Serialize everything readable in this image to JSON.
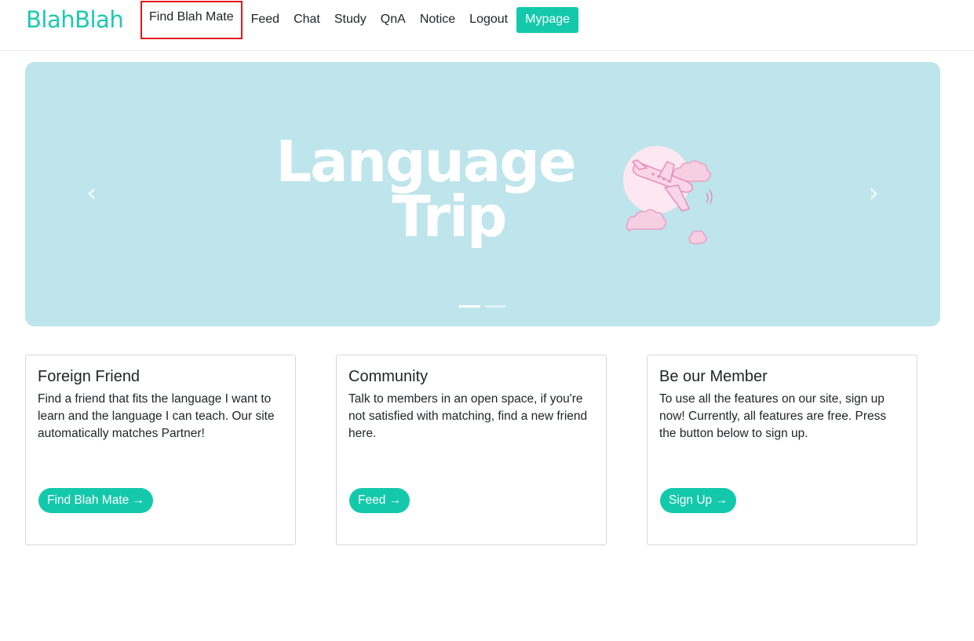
{
  "brand": "BlahBlah",
  "nav": {
    "items": [
      "Find Blah Mate",
      "Feed",
      "Chat",
      "Study",
      "QnA",
      "Notice",
      "Logout"
    ],
    "mypage": "Mypage"
  },
  "carousel": {
    "title_line1": "Language",
    "title_line2": "Trip",
    "prev_icon": "‹",
    "next_icon": "›",
    "slides": 2,
    "active_slide": 1
  },
  "cards": [
    {
      "title": "Foreign Friend",
      "text": "Find a friend that fits the language I want to learn and the language I can teach. Our site automatically matches Partner!",
      "button": "Find Blah Mate →"
    },
    {
      "title": "Community",
      "text": "Talk to members in an open space, if you're not satisfied with matching, find a new friend here.",
      "button": "Feed →"
    },
    {
      "title": "Be our Member",
      "text": "To use all the features on our site, sign up now! Currently, all features are free. Press the button below to sign up.",
      "button": "Sign Up →"
    }
  ],
  "colors": {
    "accent": "#14c9ab",
    "brand": "#1cc9b0",
    "carousel_bg": "#bee5eb",
    "highlight_box": "#e2161c",
    "art_pink": "#f7cfe2"
  }
}
